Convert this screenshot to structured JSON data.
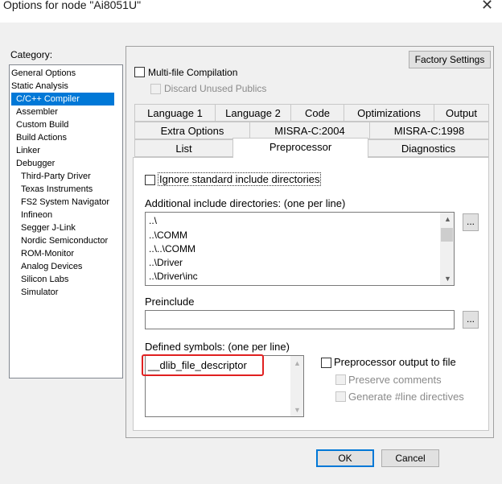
{
  "window": {
    "title": "Options for node \"Ai8051U\"",
    "close_glyph": "✕"
  },
  "category": {
    "label": "Category:",
    "items": [
      "General Options",
      "Static Analysis",
      "C/C++ Compiler",
      "Assembler",
      "Custom Build",
      "Build Actions",
      "Linker",
      "Debugger",
      "Third-Party Driver",
      "Texas Instruments",
      "FS2 System Navigator",
      "Infineon",
      "Segger J-Link",
      "Nordic Semiconductor",
      "ROM-Monitor",
      "Analog Devices",
      "Silicon Labs",
      "Simulator"
    ],
    "selected": "C/C++ Compiler"
  },
  "panel": {
    "factory_settings": "Factory Settings",
    "multifile": "Multi-file Compilation",
    "discard_unused": "Discard Unused Publics"
  },
  "tabs": {
    "row1": [
      "Language 1",
      "Language 2",
      "Code",
      "Optimizations",
      "Output"
    ],
    "row2": [
      "Extra Options",
      "MISRA-C:2004",
      "MISRA-C:1998"
    ],
    "row3": [
      "List",
      "Preprocessor",
      "Diagnostics"
    ],
    "active": "Preprocessor"
  },
  "preprocessor": {
    "ignore_std": "Ignore standard include directories",
    "additional_label": "Additional include directories: (one per line)",
    "include_dirs": [
      "..\\",
      "..\\COMM",
      "..\\..\\COMM",
      "..\\Driver",
      "..\\Driver\\inc"
    ],
    "preinclude_label": "Preinclude",
    "preinclude_value": "",
    "defined_label": "Defined symbols: (one per line)",
    "defined_symbols": [
      "__dlib_file_descriptor"
    ],
    "output_to_file": "Preprocessor output to file",
    "preserve_comments": "Preserve comments",
    "generate_line": "Generate #line directives",
    "browse": "..."
  },
  "footer": {
    "ok": "OK",
    "cancel": "Cancel"
  },
  "colors": {
    "selection": "#0078d7",
    "highlight_box": "#e02020"
  }
}
